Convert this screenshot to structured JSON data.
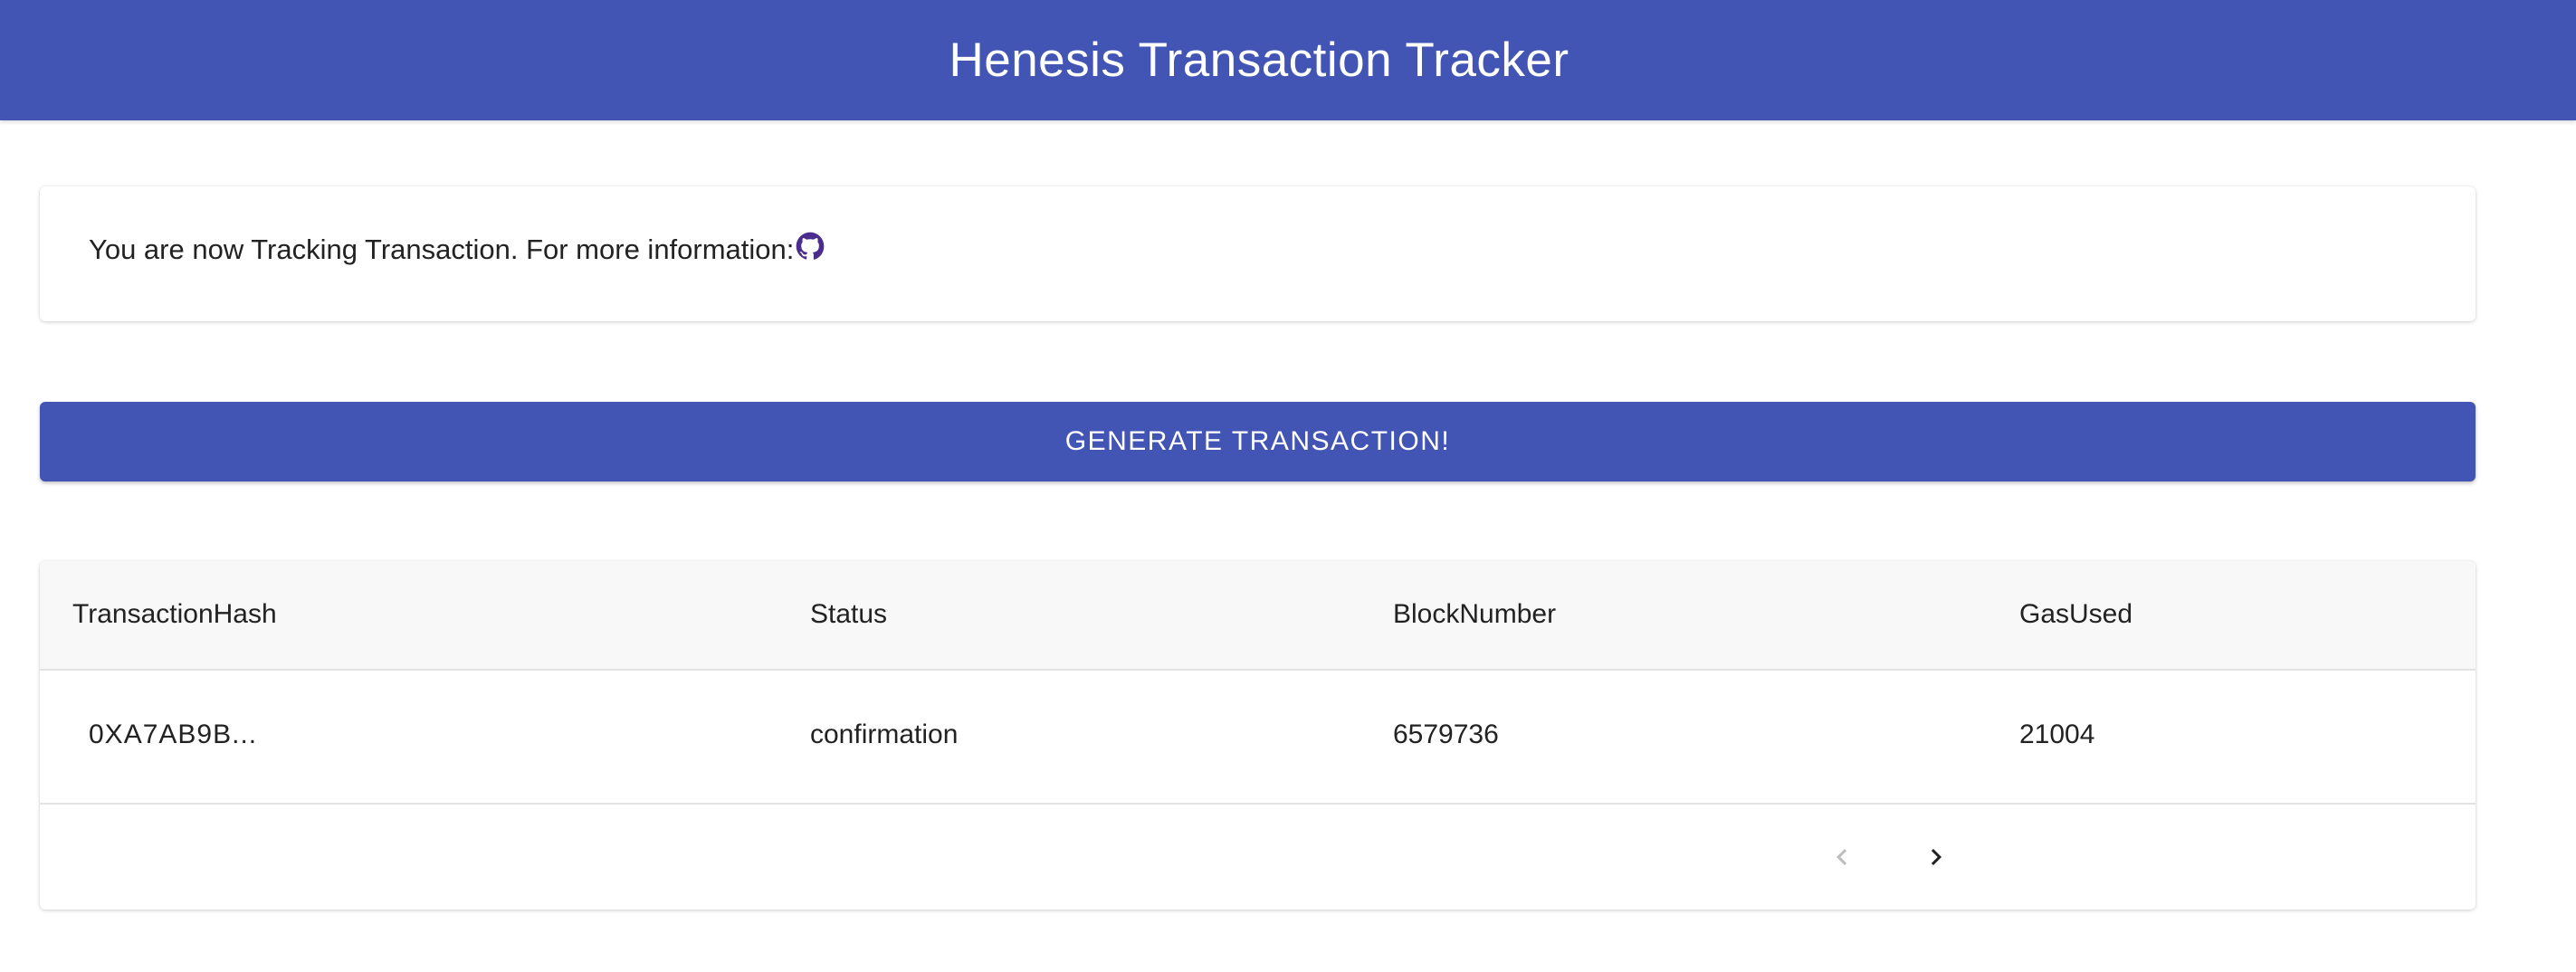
{
  "header": {
    "title": "Henesis Transaction Tracker"
  },
  "info": {
    "text": "You are now Tracking Transaction. For more information:",
    "link_icon": "github-icon"
  },
  "actions": {
    "generate_label": "GENERATE TRANSACTION!"
  },
  "table": {
    "columns": [
      "TransactionHash",
      "Status",
      "BlockNumber",
      "GasUsed"
    ],
    "rows": [
      [
        "0XA7AB9B...",
        "confirmation",
        "6579736",
        "21004"
      ]
    ]
  },
  "pagination": {
    "prev_icon": "chevron-left-icon",
    "next_icon": "chevron-right-icon",
    "prev_enabled": false,
    "next_enabled": true
  },
  "colors": {
    "primary": "#4254b4",
    "github_icon": "#4a2d8c",
    "header_row_bg": "#f8f8f8"
  }
}
